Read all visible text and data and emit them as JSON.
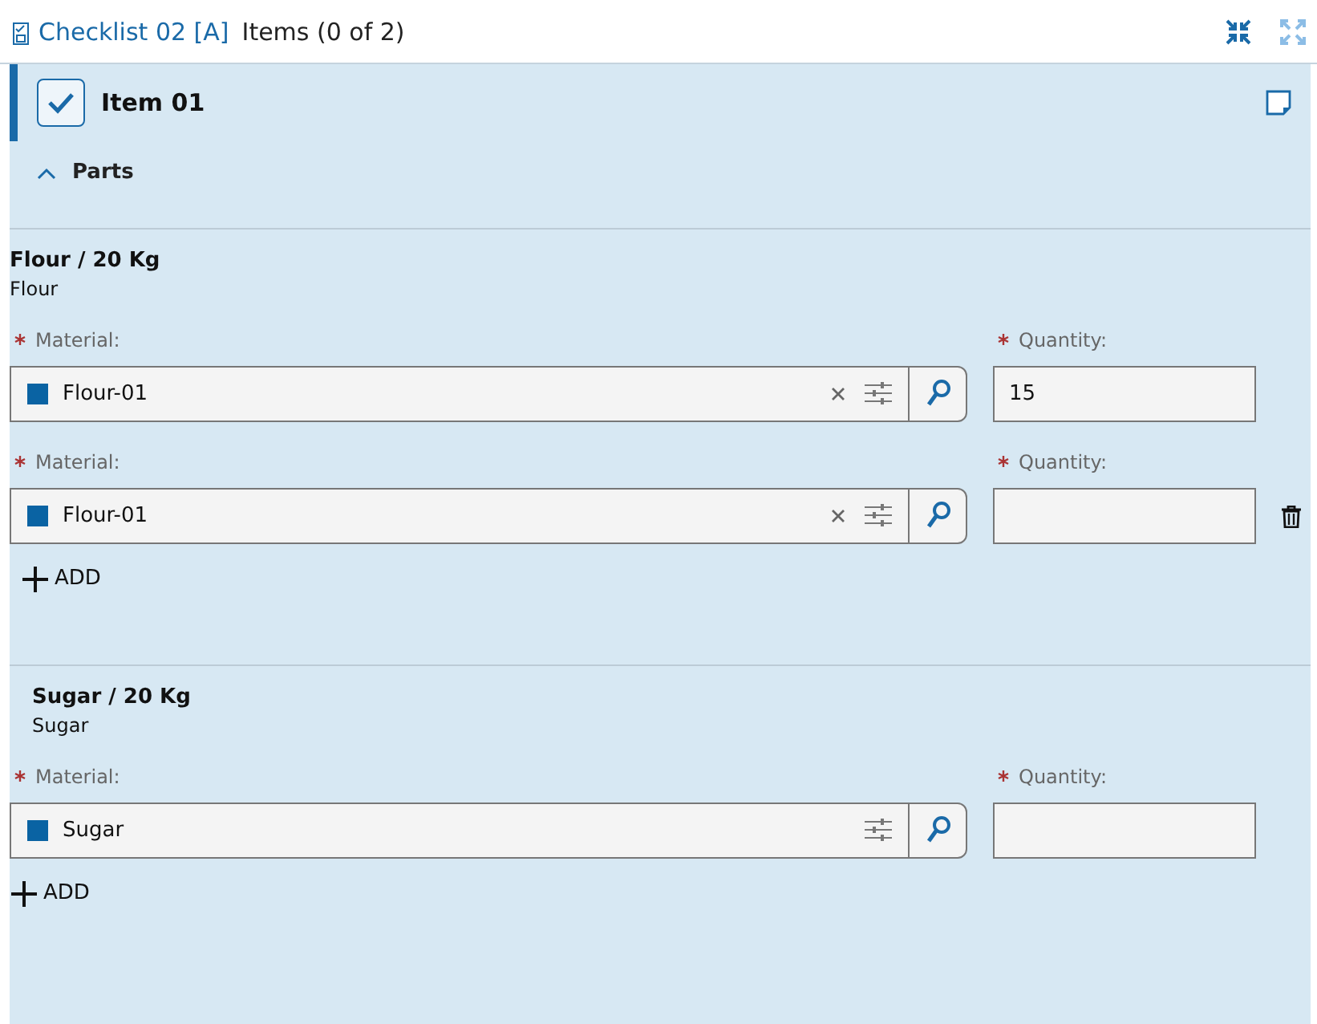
{
  "header": {
    "title": "Checklist 02 [A]",
    "subtitle": "Items (0 of 2)"
  },
  "item": {
    "title": "Item 01",
    "checked": true,
    "parts": {
      "label": "Parts",
      "expanded": true
    }
  },
  "sections": [
    {
      "title": "Flour / 20 Kg",
      "subtitle": "Flour",
      "rows": [
        {
          "material_label": "Material:",
          "material": "Flour-01",
          "clearable": true,
          "quantity_label": "Quantity:",
          "quantity": "15",
          "deletable": false
        },
        {
          "material_label": "Material:",
          "material": "Flour-01",
          "clearable": true,
          "quantity_label": "Quantity:",
          "deletable": true
        }
      ],
      "add": "ADD"
    },
    {
      "title": "Sugar / 20 Kg",
      "subtitle": "Sugar",
      "rows": [
        {
          "material_label": "Material:",
          "material": "Sugar",
          "clearable": false,
          "quantity_label": "Quantity:",
          "deletable": false
        }
      ],
      "add": "ADD"
    }
  ]
}
